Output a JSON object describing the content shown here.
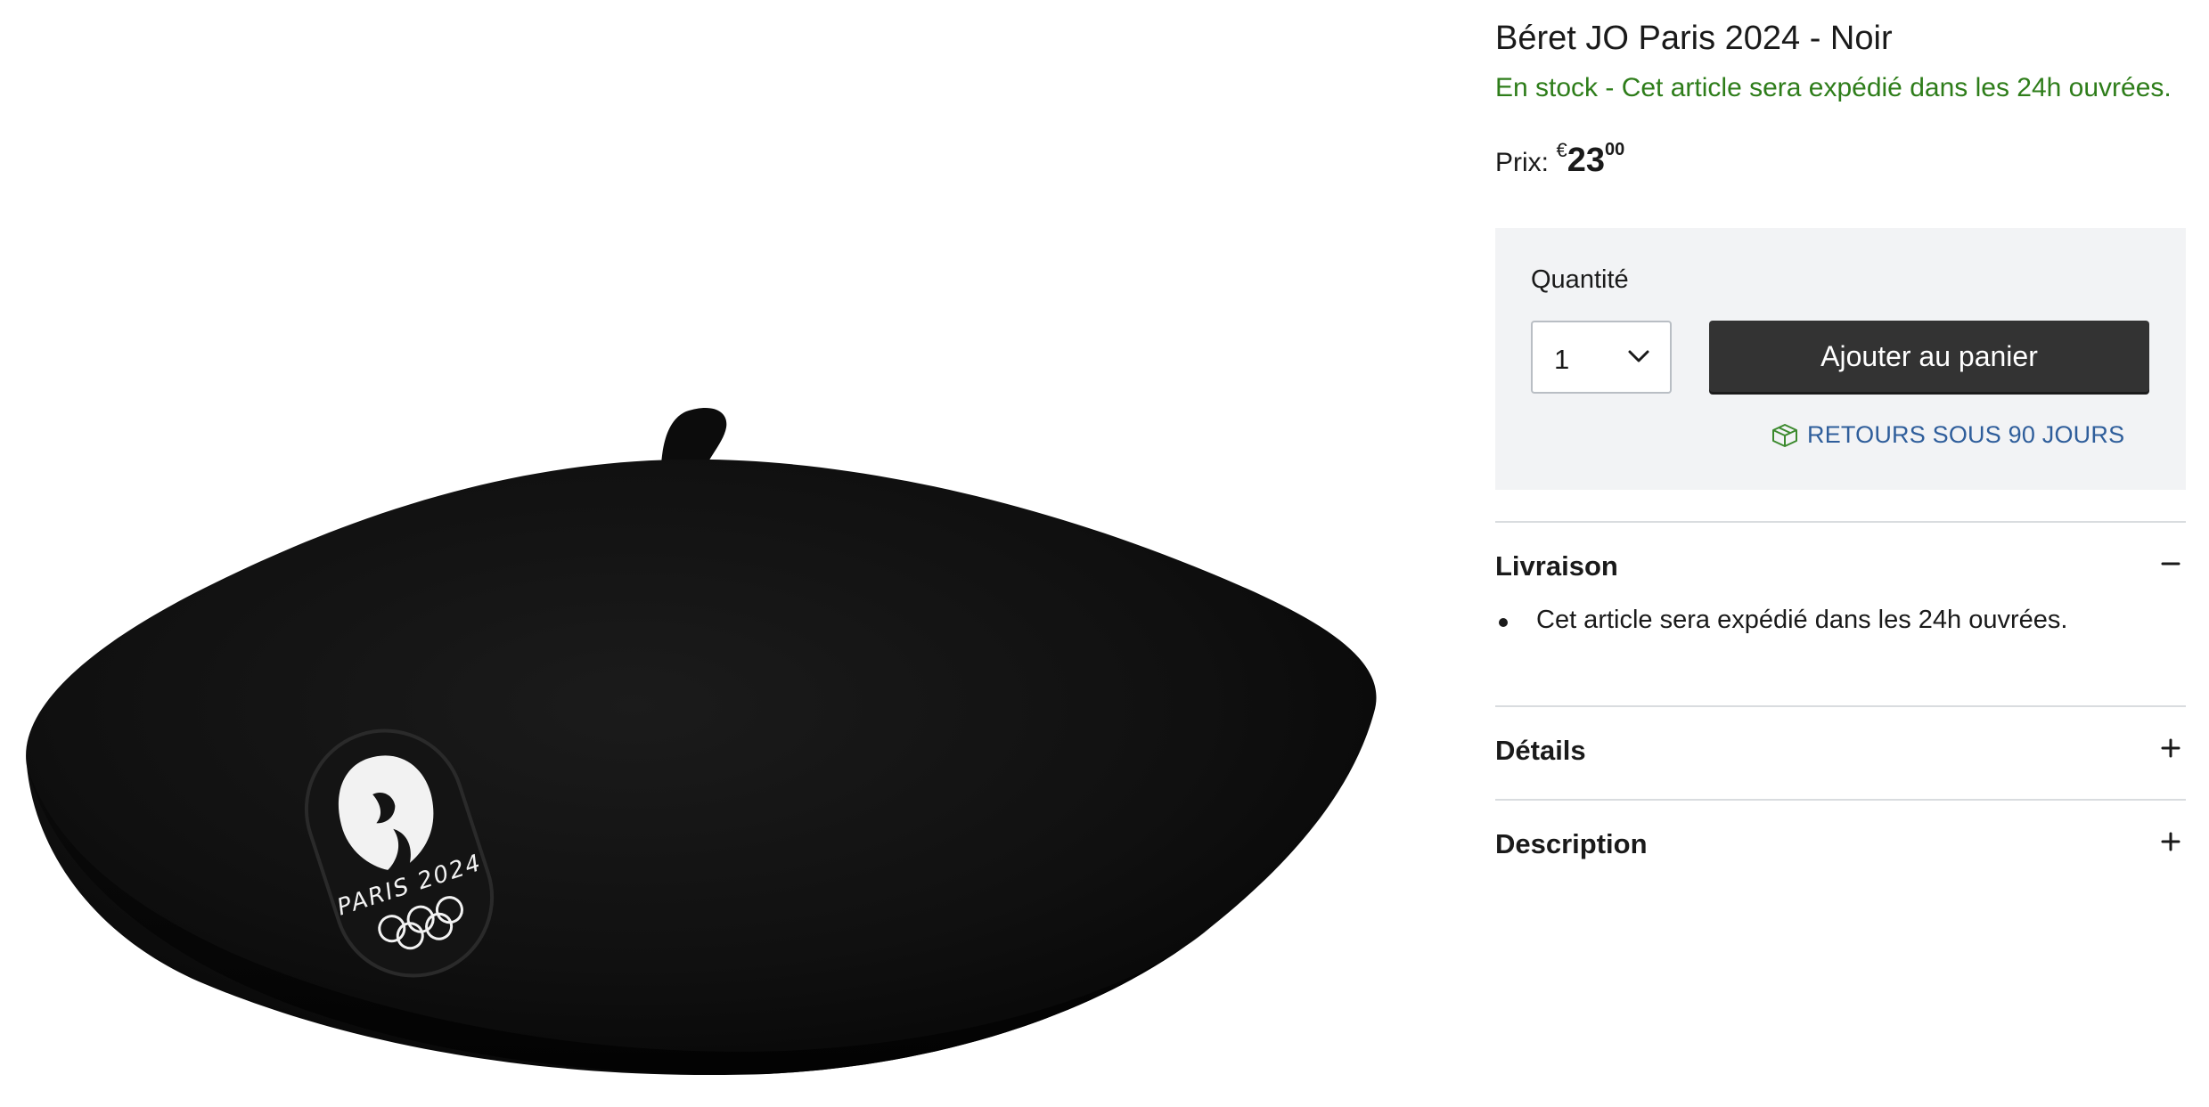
{
  "product": {
    "title": "Béret JO Paris 2024 - Noir",
    "stock_status": "En stock - Cet article sera expédié dans les 24h ouvrées.",
    "price_label": "Prix:",
    "price_currency": "€",
    "price_main": "23",
    "price_cents": "00",
    "image": {
      "alt": "black beret with Paris 2024 Olympic patch",
      "patch_text": "PARIS 2024"
    }
  },
  "buy_box": {
    "quantity_label": "Quantité",
    "quantity_value": "1",
    "add_to_cart_label": "Ajouter au panier",
    "returns_label": "RETOURS SOUS 90 JOURS",
    "returns_icon": "box-return-icon"
  },
  "sections": {
    "delivery": {
      "title": "Livraison",
      "toggle_icon": "minus-icon",
      "expanded": true,
      "items": [
        "Cet article sera expédié dans les 24h ouvrées."
      ]
    },
    "details": {
      "title": "Détails",
      "toggle_icon": "plus-icon",
      "expanded": false
    },
    "description": {
      "title": "Description",
      "toggle_icon": "plus-icon",
      "expanded": false
    }
  },
  "colors": {
    "stock_green": "#2e7d1a",
    "button_dark": "#333333",
    "link_blue": "#2f5e9b",
    "panel_gray": "#f2f3f5"
  }
}
